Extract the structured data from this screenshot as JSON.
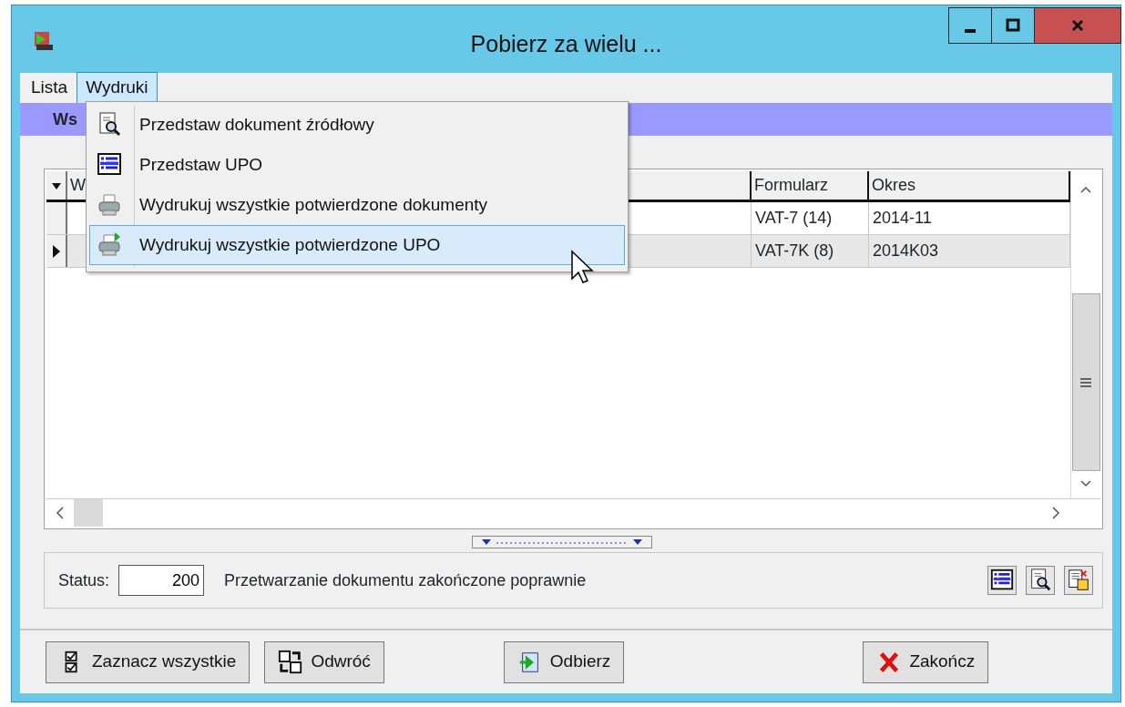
{
  "window": {
    "title": "Pobierz za wielu ..."
  },
  "menu_bar": [
    {
      "label": "Lista",
      "selected": false
    },
    {
      "label": "Wydruki",
      "selected": true
    }
  ],
  "dropdown": [
    {
      "label": "Przedstaw dokument źródłowy",
      "kind": "preview",
      "selected": false
    },
    {
      "label": "Przedstaw UPO",
      "kind": "list",
      "selected": false
    },
    {
      "label": "Wydrukuj wszystkie potwierdzone dokumenty",
      "kind": "print",
      "selected": false
    },
    {
      "label": "Wydrukuj wszystkie potwierdzone UPO",
      "kind": "print-arrow",
      "selected": true
    }
  ],
  "banner": {
    "text": "Ws"
  },
  "table": {
    "columns": [
      "W",
      "Formularz",
      "Okres"
    ],
    "rows": [
      {
        "form": "VAT-7 (14)",
        "period": "2014-11",
        "selected": false
      },
      {
        "form": "VAT-7K (8)",
        "period": "2014K03",
        "selected": true
      }
    ]
  },
  "status": {
    "label": "Status:",
    "code": "200",
    "message": "Przetwarzanie dokumentu zakończone poprawnie"
  },
  "buttons": [
    {
      "label": "Zaznacz wszystkie",
      "kind": "check-all"
    },
    {
      "label": "Odwróć",
      "kind": "invert"
    },
    {
      "label": "Odbierz",
      "kind": "receive"
    },
    {
      "label": "Zakończ",
      "kind": "close"
    }
  ]
}
